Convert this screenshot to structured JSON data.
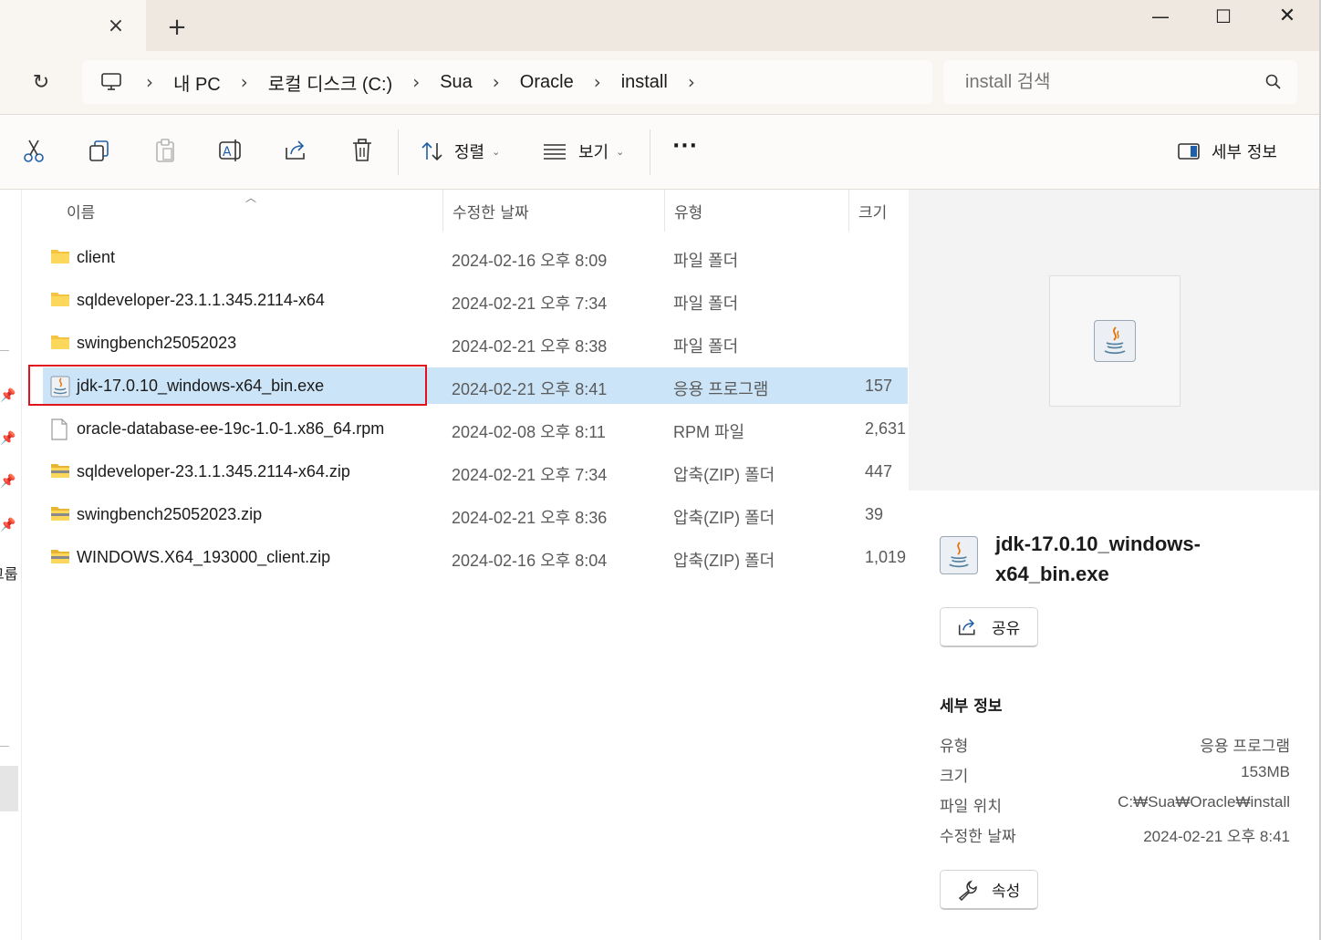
{
  "tab": {
    "close_icon": "×",
    "new_tab_icon": "+"
  },
  "window": {
    "minimize": "—",
    "maximize": "☐",
    "close": "✕"
  },
  "address": {
    "refresh_icon": "↻",
    "crumbs": [
      "내 PC",
      "로컬 디스크 (C:)",
      "Sua",
      "Oracle",
      "install"
    ],
    "separator": "›",
    "search_placeholder": "install 검색"
  },
  "toolbar": {
    "sort_label": "정렬",
    "view_label": "보기",
    "more_label": "···",
    "details_label": "세부 정보"
  },
  "columns": {
    "name": "이름",
    "date": "수정한 날짜",
    "type": "유형",
    "size": "크기"
  },
  "files": [
    {
      "name": "client",
      "date": "2024-02-16 오후 8:09",
      "type": "파일 폴더",
      "size": "",
      "icon": "folder-icon"
    },
    {
      "name": "sqldeveloper-23.1.1.345.2114-x64",
      "date": "2024-02-21 오후 7:34",
      "type": "파일 폴더",
      "size": "",
      "icon": "folder-icon"
    },
    {
      "name": "swingbench25052023",
      "date": "2024-02-21 오후 8:38",
      "type": "파일 폴더",
      "size": "",
      "icon": "folder-icon"
    },
    {
      "name": "jdk-17.0.10_windows-x64_bin.exe",
      "date": "2024-02-21 오후 8:41",
      "type": "응용 프로그램",
      "size": "157",
      "icon": "java-exe-icon",
      "selected": true
    },
    {
      "name": "oracle-database-ee-19c-1.0-1.x86_64.rpm",
      "date": "2024-02-08 오후 8:11",
      "type": "RPM 파일",
      "size": "2,631",
      "icon": "file-icon"
    },
    {
      "name": "sqldeveloper-23.1.1.345.2114-x64.zip",
      "date": "2024-02-21 오후 7:34",
      "type": "압축(ZIP) 폴더",
      "size": "447",
      "icon": "zip-folder-icon"
    },
    {
      "name": "swingbench25052023.zip",
      "date": "2024-02-21 오후 8:36",
      "type": "압축(ZIP) 폴더",
      "size": "39",
      "icon": "zip-folder-icon"
    },
    {
      "name": "WINDOWS.X64_193000_client.zip",
      "date": "2024-02-16 오후 8:04",
      "type": "압축(ZIP) 폴더",
      "size": "1,019",
      "icon": "zip-folder-icon"
    }
  ],
  "leftnav": {
    "partial_label": "그룹"
  },
  "details": {
    "title": "jdk-17.0.10_windows-x64_bin.exe",
    "share_label": "공유",
    "section_title": "세부 정보",
    "properties": [
      {
        "label": "유형",
        "value": "응용 프로그램"
      },
      {
        "label": "크기",
        "value": "153MB"
      },
      {
        "label": "파일 위치",
        "value": "C:₩Sua₩Oracle₩install"
      },
      {
        "label": "수정한 날짜",
        "value": "2024-02-21 오후 8:41"
      }
    ],
    "properties_button": "속성"
  },
  "colors": {
    "selection": "#cce4f7",
    "highlight_border": "#e0141c",
    "folder": "#f5c342",
    "accent": "#0067c0"
  }
}
